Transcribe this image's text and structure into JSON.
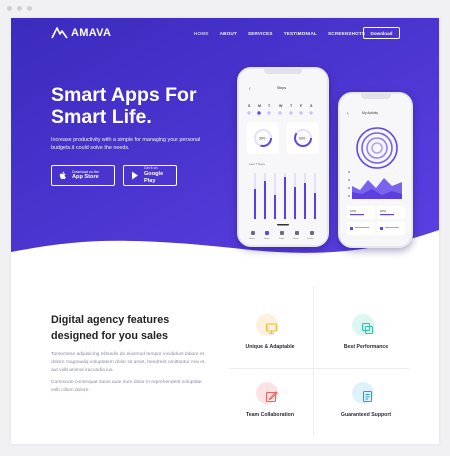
{
  "brand": {
    "name": "AMAVA"
  },
  "nav": {
    "links": [
      "HOME",
      "ABOUT",
      "SERVICES",
      "TESTIMONIAL",
      "SCREENSHOTS"
    ],
    "download_label": "Download"
  },
  "hero": {
    "title_line1": "Smart Apps For",
    "title_line2": "Smart Life.",
    "description": "Increase productivity with a simple for managing your personal budgets.it could solve the needs.",
    "app_store": {
      "small": "Download on the",
      "big": "App Store"
    },
    "google_play": {
      "small": "Get it on",
      "big": "Google Play"
    }
  },
  "phone1": {
    "title": "Steps",
    "days": [
      "S",
      "M",
      "T",
      "W",
      "T",
      "F",
      "S"
    ],
    "ring1": "30%",
    "ring2": "60%",
    "chart_label": "Last 7 Days",
    "nav_items": [
      "Home",
      "Steps",
      "Inbox",
      "Notes",
      "Profile"
    ]
  },
  "phone2": {
    "title": "My Activity",
    "stat1": "10%",
    "stat2": "20%"
  },
  "features": {
    "heading_line1": "Digital agency features",
    "heading_line2": "designed for you sales",
    "para1": "Torsectetur adipisicing elitsedis do eiusmod tempor incididunt labore et dolore magnaaliq voluptatem dolor sit amet, hendrerit omittantur mei et, aut vidit animal iracundia ius.",
    "para2": "Commodo consequat duuis aute irure dolor in reprehenderit voluptate velit cillum dolore.",
    "items": [
      {
        "label": "Unique & Adaptable",
        "icon": "monitor-icon",
        "blob_color": "#fdf1dc",
        "icon_color": "#f5b83d"
      },
      {
        "label": "Best Performance",
        "icon": "layers-icon",
        "blob_color": "#dcf7f1",
        "icon_color": "#2cc5a5"
      },
      {
        "label": "Team Collaboration",
        "icon": "edit-icon",
        "blob_color": "#fde3e3",
        "icon_color": "#f0605f"
      },
      {
        "label": "Guaranteed Support",
        "icon": "document-icon",
        "blob_color": "#dff2fb",
        "icon_color": "#2a9fd6"
      }
    ]
  },
  "colors": {
    "hero_start": "#3a2bb8",
    "hero_end": "#5a3fe0",
    "accent": "#6146e5"
  }
}
